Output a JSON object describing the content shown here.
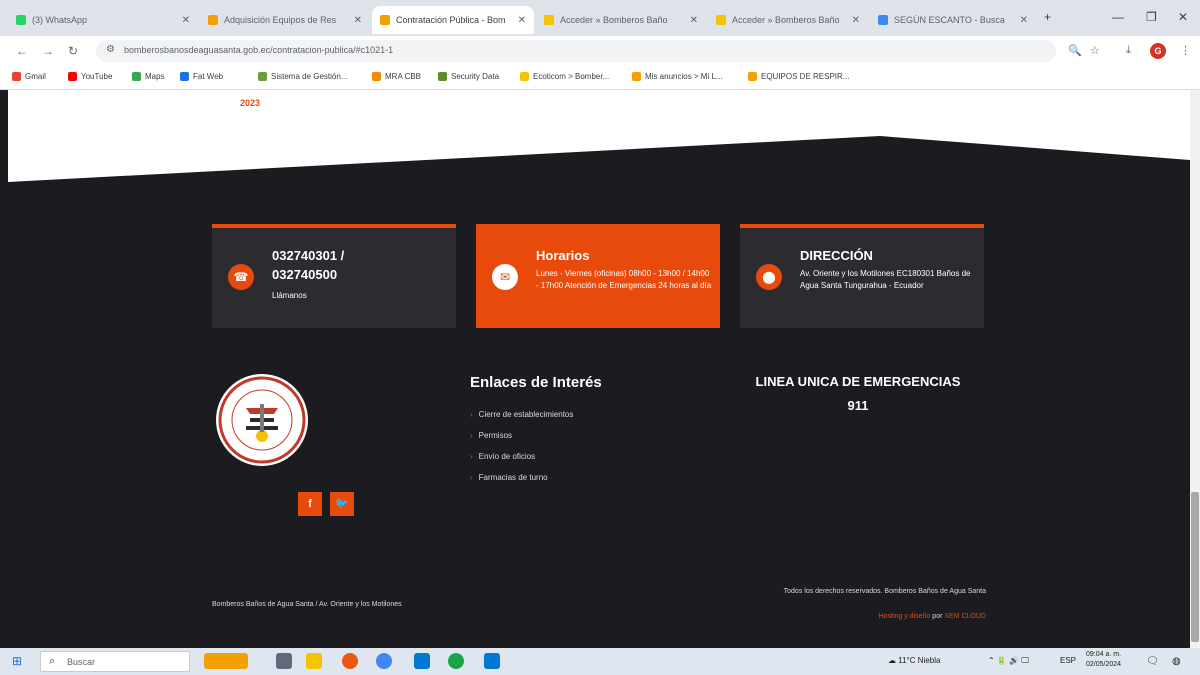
{
  "browser": {
    "tabs": [
      {
        "title": "(3) WhatsApp",
        "color": "#25d366"
      },
      {
        "title": "Adquisición Equipos de Res",
        "color": "#f4a000"
      },
      {
        "title": "Contratación Pública - Bom",
        "color": "#f4a000"
      },
      {
        "title": "Acceder » Bomberos Baño",
        "color": "#f4c400"
      },
      {
        "title": "Acceder » Bomberos Baño",
        "color": "#f4c400"
      },
      {
        "title": "SEGÚN ESCANTO - Busca",
        "color": "#4285f4"
      }
    ],
    "new_tab": "+",
    "url": "bomberosbanosdeaguasanta.gob.ec/contratacion-publica/#c1021-1",
    "bookmarks": [
      {
        "label": "Gmail",
        "color": "#ea4335"
      },
      {
        "label": "YouTube",
        "color": "#ff0000"
      },
      {
        "label": "Maps",
        "color": "#34a853"
      },
      {
        "label": "Fat Web",
        "color": "#1a73e8"
      },
      {
        "label": "Sistema de Gestión...",
        "color": "#6a9f3b"
      },
      {
        "label": "MRA CBB",
        "color": "#f28b00"
      },
      {
        "label": "Security Data",
        "color": "#5a8f29"
      },
      {
        "label": "Ecoticom > Bomber...",
        "color": "#f4c400"
      },
      {
        "label": "Mis anuncios > Mi L...",
        "color": "#f4a000"
      },
      {
        "label": "EQUIPOS DE RESPIR...",
        "color": "#f4a000"
      }
    ],
    "profile_initial": "G"
  },
  "page": {
    "top_card_year": "2023",
    "cards": [
      {
        "title_lines": [
          "032740301 /",
          "032740500"
        ],
        "sub": "Llámanos",
        "icon": "phone-icon",
        "glyph": "☎"
      },
      {
        "title_lines": [
          "Horarios"
        ],
        "sub": "Lunes - Viernes (oficinas) 08h00 - 13h00 / 14h00 - 17h00 Atención de Emergencias 24 horas al día",
        "icon": "mail-icon",
        "glyph": "✉"
      },
      {
        "title_lines": [
          "DIRECCIÓN"
        ],
        "sub": "Av. Oriente y los Motilones EC180301 Baños de Agua Santa Tungurahua - Ecuador",
        "icon": "location-icon",
        "glyph": "⬤"
      }
    ],
    "links_title": "Enlaces de Interés",
    "links": [
      "Cierre de establecimientos",
      "Permisos",
      "Envío de oficios",
      "Farmacias de turno"
    ],
    "emergency_title": "LINEA UNICA DE EMERGENCIAS",
    "emergency_number": "911",
    "social": [
      {
        "label": "f",
        "icon": "facebook-icon"
      },
      {
        "label": "🐦",
        "icon": "twitter-icon"
      }
    ],
    "footer_left": "Bomberos Baños de Agua Santa / Av. Oriente y los Motilones",
    "footer_right": "Todos los derechos reservados. Bomberos Baños de Agua Santa",
    "footer_credit_a": "Hosting y diseño",
    "footer_credit_by": "por",
    "footer_credit_b": "XEM CLOUD"
  },
  "taskbar": {
    "search_placeholder": "Buscar",
    "weather": "11°C  Niebla",
    "lang": "ESP",
    "time": "09:04 a. m.",
    "date": "02/05/2024"
  },
  "colors": {
    "accent": "#e84a0c",
    "footer_bg": "#1c1b20",
    "card_bg": "#2c2b30"
  }
}
